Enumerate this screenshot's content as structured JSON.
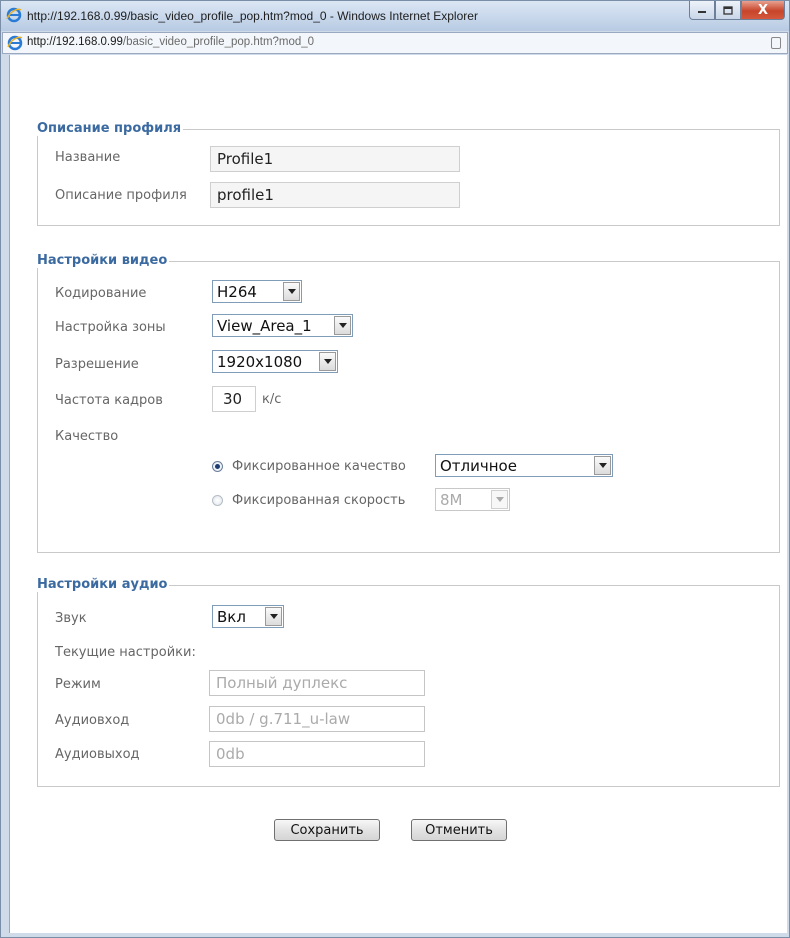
{
  "window": {
    "title": "http://192.168.0.99/basic_video_profile_pop.htm?mod_0 - Windows Internet Explorer",
    "address_host": "http://192.168.0.99",
    "address_path": "/basic_video_profile_pop.htm?mod_0",
    "close_glyph": "X"
  },
  "profile": {
    "legend": "Описание профиля",
    "name_label": "Название",
    "name_value": "Profile1",
    "desc_label": "Описание профиля",
    "desc_value": "profile1"
  },
  "video": {
    "legend": "Настройки видео",
    "encoding_label": "Кодирование",
    "encoding_value": "H264",
    "zone_label": "Настройка зоны",
    "zone_value": "View_Area_1",
    "resolution_label": "Разрешение",
    "resolution_value": "1920x1080",
    "fps_label": "Частота кадров",
    "fps_value": "30",
    "fps_unit": "к/с",
    "quality_label": "Качество",
    "fixed_quality_label": "Фиксированное качество",
    "fixed_quality_value": "Отличное",
    "fixed_quality_checked": true,
    "fixed_bitrate_label": "Фиксированная скорость",
    "fixed_bitrate_value": "8M",
    "fixed_bitrate_checked": false
  },
  "audio": {
    "legend": "Настройки аудио",
    "sound_label": "Звук",
    "sound_value": "Вкл",
    "current_label": "Текущие настройки:",
    "mode_label": "Режим",
    "mode_value": "Полный дуплекс",
    "input_label": "Аудиовход",
    "input_value": "0db / g.711_u-law",
    "output_label": "Аудиовыход",
    "output_value": "0db"
  },
  "actions": {
    "save_label": "Сохранить",
    "cancel_label": "Отменить"
  }
}
